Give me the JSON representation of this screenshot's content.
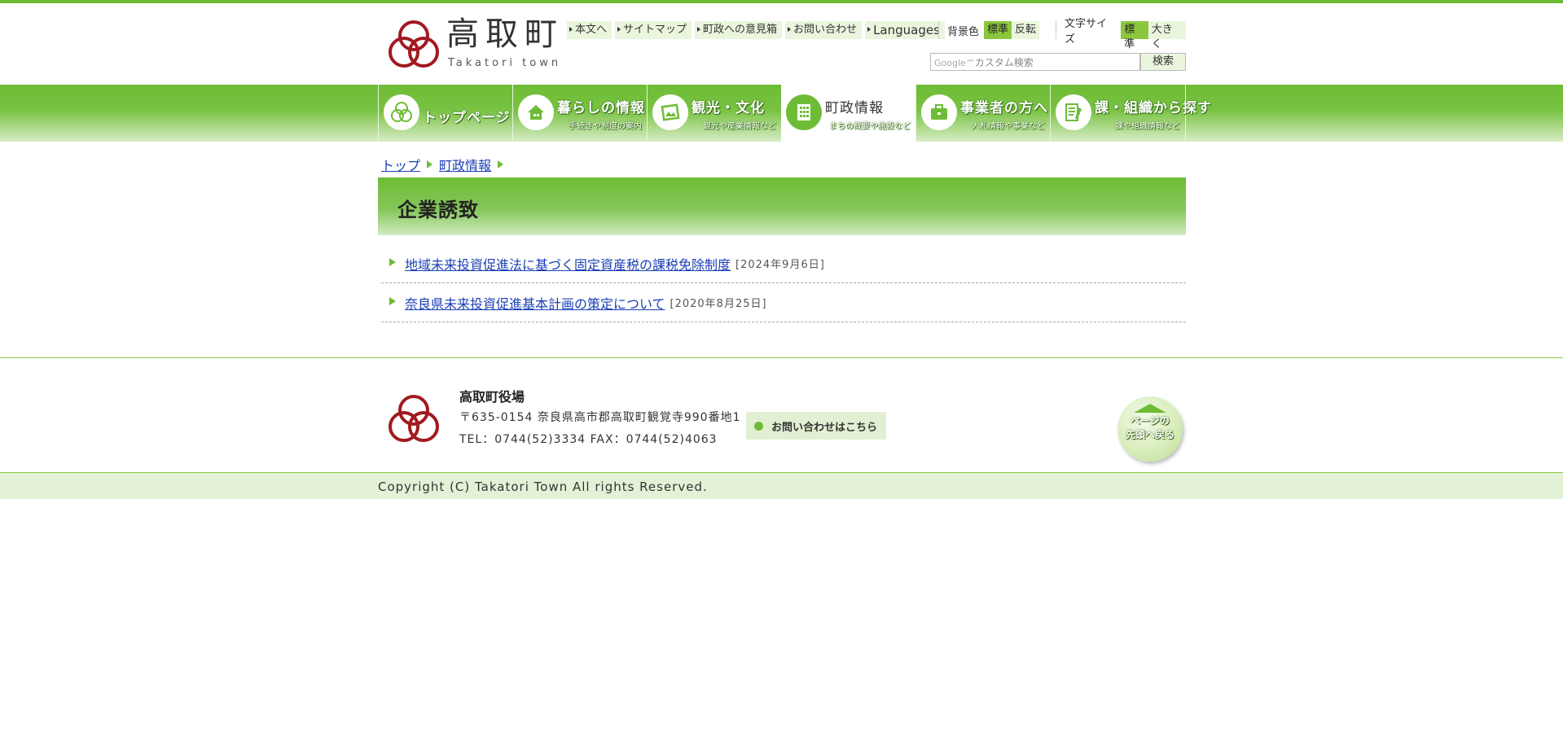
{
  "header": {
    "site_name": "高取町",
    "site_sub": "Takatori town",
    "util_links": [
      "本文へ",
      "サイトマップ",
      "町政への意見箱",
      "お問い合わせ",
      "Languages"
    ],
    "bg_color": {
      "label": "背景色",
      "options": [
        "標準",
        "反転"
      ],
      "active": 0
    },
    "font_size": {
      "label": "文字サイズ",
      "options": [
        "標準",
        "大きく"
      ],
      "active": 0
    },
    "search": {
      "placeholder": "カスタム検索",
      "brand": "Google™",
      "button": "検索"
    }
  },
  "nav": {
    "items": [
      {
        "label": "トップページ",
        "sub": "",
        "icon": "three-circles-icon",
        "active": false
      },
      {
        "label": "暮らしの情報",
        "sub": "手続きや制度の案内",
        "icon": "house-icon",
        "active": false
      },
      {
        "label": "観光・文化",
        "sub": "観光や産業情報など",
        "icon": "picture-icon",
        "active": false
      },
      {
        "label": "町政情報",
        "sub": "まちの概要や施設など",
        "icon": "building-icon",
        "active": true
      },
      {
        "label": "事業者の方へ",
        "sub": "入札情報や事業など",
        "icon": "briefcase-icon",
        "active": false
      },
      {
        "label": "課・組織から探す",
        "sub": "課や組織情報など",
        "icon": "document-pencil-icon",
        "active": false
      }
    ]
  },
  "breadcrumb": [
    "トップ",
    "町政情報"
  ],
  "page": {
    "title": "企業誘致",
    "items": [
      {
        "title": "地域未来投資促進法に基づく固定資産税の課税免除制度",
        "date": "[2024年9月6日]"
      },
      {
        "title": "奈良県未来投資促進基本計画の策定について",
        "date": "[2020年8月25日]"
      }
    ]
  },
  "footer": {
    "office_name": "高取町役場",
    "address": "〒635-0154 奈良県高市郡高取町観覚寺990番地1",
    "tel": "TEL：0744(52)3334 FAX：0744(52)4063",
    "contact_label": "お問い合わせはこちら",
    "pagetop_line1": "ページの",
    "pagetop_line2": "先頭へ戻る",
    "copyright": "Copyright (C) Takatori Town All rights Reserved."
  },
  "colors": {
    "brand_green": "#6ebc35",
    "logo_red": "#a11a1f",
    "link": "#1a3fb5"
  }
}
